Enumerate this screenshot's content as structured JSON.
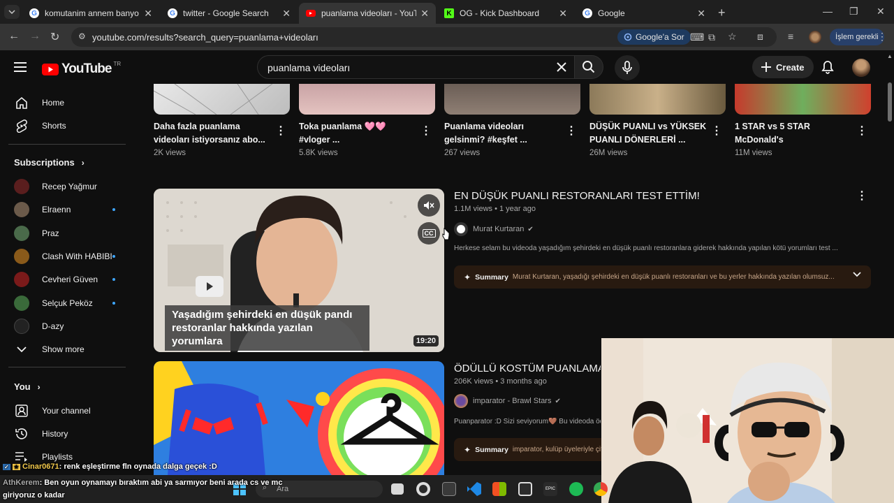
{
  "browser": {
    "tabs": [
      {
        "title": "komutanim annem banyo yaptı",
        "favicon": "google-icon",
        "active": false
      },
      {
        "title": "twitter - Google Search",
        "favicon": "google-icon",
        "active": false
      },
      {
        "title": "puanlama videoları - YouTube",
        "favicon": "youtube-icon",
        "active": true
      },
      {
        "title": "OG - Kick Dashboard",
        "favicon": "kick-icon",
        "active": false
      },
      {
        "title": "Google",
        "favicon": "google-icon",
        "active": false
      }
    ],
    "url": "youtube.com/results?search_query=puanlama+videoları",
    "google_sor_label": "Google'a Sor",
    "islem_label": "İşlem gerekli"
  },
  "youtube": {
    "logo_text": "YouTube",
    "country_code": "TR",
    "search_query": "puanlama videoları",
    "create_label": "Create"
  },
  "sidebar": {
    "home": "Home",
    "shorts": "Shorts",
    "subscriptions_heading": "Subscriptions",
    "subscriptions": [
      {
        "name": "Recep Yağmur",
        "new": false,
        "color": "#5a1e1e"
      },
      {
        "name": "Elraenn",
        "new": true,
        "color": "#6b5a4a"
      },
      {
        "name": "Praz",
        "new": false,
        "color": "#4a6a4a"
      },
      {
        "name": "Clash With HABIBI",
        "new": true,
        "color": "#8a5a1a"
      },
      {
        "name": "Cevheri Güven",
        "new": true,
        "color": "#7a1a1a"
      },
      {
        "name": "Selçuk Peköz",
        "new": true,
        "color": "#3a6a3a"
      },
      {
        "name": "D-azy",
        "new": false,
        "color": "#222222"
      }
    ],
    "show_more": "Show more",
    "you_heading": "You",
    "your_channel": "Your channel",
    "history": "History",
    "playlists": "Playlists"
  },
  "top_row": [
    {
      "title": "Daha fazla puanlama videoları istiyorsanız abo...",
      "views": "2K views"
    },
    {
      "title": "Toka puanlama 🩷🩷 #vloger ...",
      "views": "5.8K views"
    },
    {
      "title": "Puanlama videoları gelsinmi? #keşfet ...",
      "views": "267 views"
    },
    {
      "title": "DÜŞÜK PUANLI vs YÜKSEK PUANLI DÖNERLERİ ...",
      "views": "26M views"
    },
    {
      "title": "1 STAR vs 5 STAR McDonald's",
      "views": "11M views"
    }
  ],
  "results": [
    {
      "title": "EN DÜŞÜK PUANLI RESTORANLARI TEST ETTİM!",
      "views": "1.1M views",
      "age": "1 year ago",
      "channel": "Murat Kurtaran",
      "description": "Herkese selam bu videoda yaşadığım şehirdeki en düşük puanlı restoranlara giderek hakkında yapılan kötü yorumları test ...",
      "summary_label": "Summary",
      "summary_text": "Murat Kurtaran, yaşadığı şehirdeki en düşük puanlı restoranları ve bu yerler hakkında yazılan olumsuz...",
      "thumb_caption": "Yaşadığım şehirdeki en düşük pandı restoranlar hakkında yazılan yorumlara",
      "duration": "19:20",
      "cc_label": "CC"
    },
    {
      "title": "ÖDÜLLÜ KOSTÜM PUANLAMA Y",
      "views": "206K views",
      "age": "3 months ago",
      "channel": "imparator - Brawl Stars",
      "description": "Puanparator :D Sizi seviyorum🤎 Bu videoda ödü",
      "summary_label": "Summary",
      "summary_text": "imparator, kulüp üyeleriyle çift"
    }
  ],
  "taskbar": {
    "search_placeholder": "Ara"
  },
  "chat": [
    {
      "user": "Cinar0671",
      "message": ": renk eşleştirme fln oynada dalga geçek :D"
    },
    {
      "user": "AthKerem",
      "message": ": Ben oyun oynamayı bıraktım abi ya sarmıyor beni arada cs ve mc"
    },
    {
      "user": "",
      "message": "giriyoruz o kadar"
    }
  ],
  "colors": {
    "youtube_red": "#ff0000",
    "accent_blue": "#3ea6ff",
    "summary_bg": "#281a10"
  }
}
